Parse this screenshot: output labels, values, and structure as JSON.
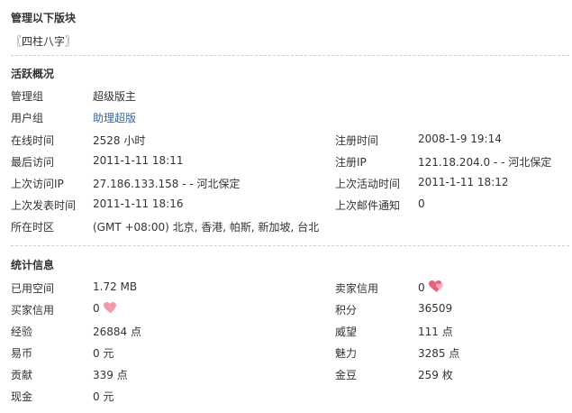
{
  "manage": {
    "title": "管理以下版块",
    "forum_link": "〖四柱八字〗"
  },
  "activity": {
    "title": "活跃概况",
    "rows": [
      {
        "l1": "管理组",
        "v1": "超级版主",
        "l2": "",
        "v2": ""
      },
      {
        "l1": "用户组",
        "v1": "助理超版",
        "l2": "",
        "v2": ""
      },
      {
        "l1": "在线时间",
        "v1": "2528 小时",
        "l2": "注册时间",
        "v2": "2008-1-9 19:14"
      },
      {
        "l1": "最后访问",
        "v1": "2011-1-11 18:11",
        "l2": "注册IP",
        "v2": "121.18.204.0 - - 河北保定"
      },
      {
        "l1": "上次访问IP",
        "v1": "27.186.133.158 - - 河北保定",
        "l2": "上次活动时间",
        "v2": "2011-1-11 18:12"
      },
      {
        "l1": "上次发表时间",
        "v1": "2011-1-11 18:16",
        "l2": "上次邮件通知",
        "v2": "0"
      },
      {
        "l1": "所在时区",
        "v1": "(GMT +08:00) 北京, 香港, 帕斯, 新加坡, 台北",
        "l2": "",
        "v2": ""
      }
    ]
  },
  "stats": {
    "title": "统计信息",
    "rows": [
      {
        "l1": "已用空间",
        "v1": "1.72 MB",
        "l2": "卖家信用",
        "v2": "0"
      },
      {
        "l1": "买家信用",
        "v1": "0",
        "l2": "积分",
        "v2": "36509"
      },
      {
        "l1": "经验",
        "v1": "26884 点",
        "l2": "威望",
        "v2": "111 点"
      },
      {
        "l1": "易币",
        "v1": "0 元",
        "l2": "魅力",
        "v2": "3285 点"
      },
      {
        "l1": "贡献",
        "v1": "339 点",
        "l2": "金豆",
        "v2": "259 枚"
      },
      {
        "l1": "现金",
        "v1": "0 元",
        "l2": "",
        "v2": ""
      }
    ]
  },
  "colors": {
    "text": "#333333",
    "link": "#336699",
    "divider": "#cfcfcf",
    "heart": "#e8627a"
  },
  "icons": {
    "credit": "heart-icon"
  }
}
